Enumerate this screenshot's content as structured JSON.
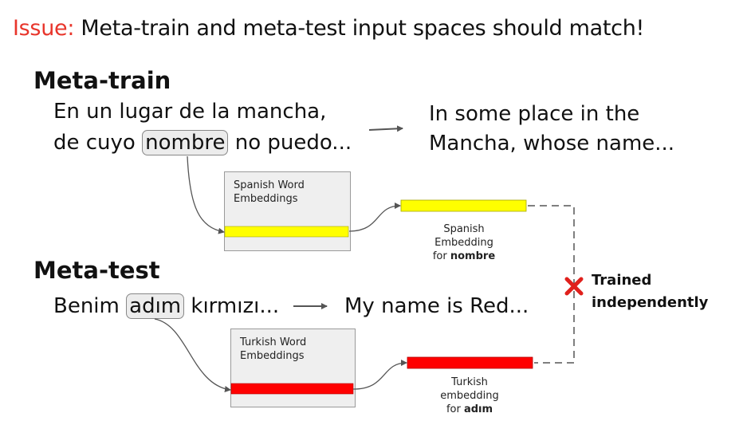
{
  "issue": {
    "label": "Issue:",
    "text": " Meta-train and meta-test input spaces should match!"
  },
  "meta_train": {
    "heading": "Meta-train",
    "source_line1": "En un lugar de la mancha,",
    "source_line2_before": "de cuyo ",
    "highlight_word": "nombre",
    "source_line2_after": " no puedo...",
    "target_line1": "In some place in the",
    "target_line2": "Mancha, whose name...",
    "embeddings_box_line1": "Spanish Word",
    "embeddings_box_line2": "Embeddings",
    "caption_line1": "Spanish",
    "caption_line2": "Embedding",
    "caption_line3_prefix": "for ",
    "caption_line3_word": "nombre",
    "bar_color": "#ffff00"
  },
  "meta_test": {
    "heading": "Meta-test",
    "source_before": "Benim ",
    "highlight_word": "adım",
    "source_after": " kırmızı...",
    "target": "My name is Red...",
    "embeddings_box_line1": "Turkish Word",
    "embeddings_box_line2": "Embeddings",
    "caption_line1": "Turkish",
    "caption_line2": "embedding",
    "caption_line3_prefix": "for ",
    "caption_line3_word": "adım",
    "bar_color": "#ff0000"
  },
  "trained": {
    "line1": "Trained",
    "line2": "independently",
    "icon": "red-x-icon"
  },
  "colors": {
    "issue_accent": "#e8352b",
    "cross": "#e0201c"
  }
}
